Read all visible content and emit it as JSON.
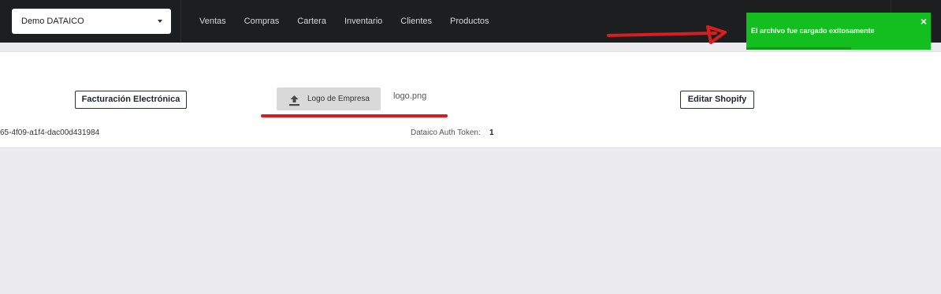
{
  "header": {
    "company_select": "Demo DATAICO",
    "nav": [
      "Ventas",
      "Compras",
      "Cartera",
      "Inventario",
      "Clientes",
      "Productos"
    ]
  },
  "toast": {
    "message": "El archivo fue cargado exitosamente",
    "close_glyph": "×",
    "progress_fraction": 0.57,
    "color": "#12bf1f"
  },
  "annotation": {
    "arrow_color": "#d61e1e",
    "underline_color": "#d61e1e"
  },
  "settings": {
    "facturacion_button": "Facturación Electrónica",
    "logo_button": "Logo de Empresa",
    "logo_icon": "upload-icon",
    "logo_filename": "logo.png",
    "shopify_button": "Editar Shopify",
    "token_id_text": "65-4f09-a1f4-dac00d431984",
    "auth_token_label": "Dataico Auth Token:",
    "auth_token_value": "1"
  }
}
